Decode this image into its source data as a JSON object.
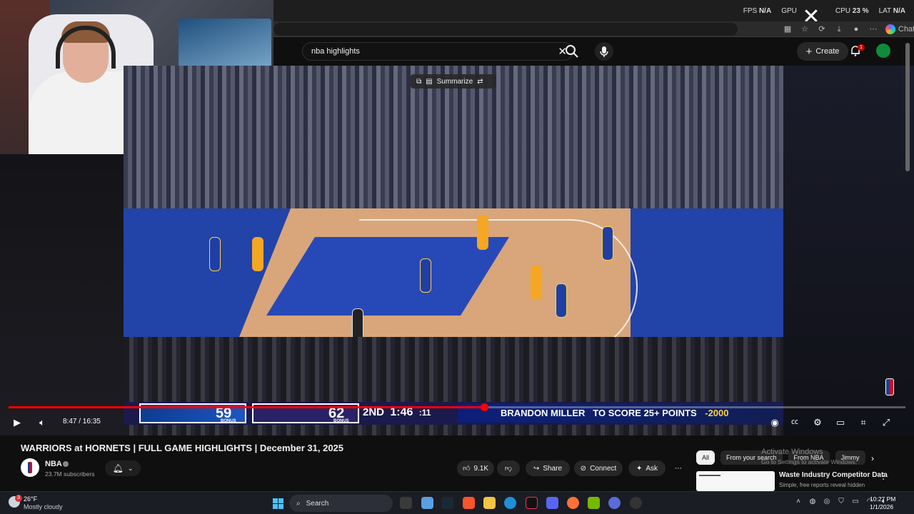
{
  "overlay": {
    "fps_label": "FPS",
    "fps_value": "N/A",
    "gpu_label": "GPU",
    "cpu_label": "CPU",
    "cpu_value": "23 %",
    "lat_label": "LAT",
    "lat_value": "N/A"
  },
  "browser": {
    "chat_label": "Chat"
  },
  "youtube": {
    "search_value": "nba highlights",
    "create_label": "Create",
    "notifications_count": "1",
    "summarize_label": "Summarize"
  },
  "scorebug": {
    "home_score": "59",
    "away_score": "62",
    "bonus_label": "BONUS",
    "period": "2ND",
    "clock": "1:46",
    "shot_clock": ":11",
    "prop_text": "BRANDON MILLER",
    "prop_line": "TO SCORE 25+ POINTS",
    "prop_odds": "-2000"
  },
  "player": {
    "current_time": "8:47",
    "duration": "16:35",
    "time_display": "8:47 / 16:35",
    "progress": 0.53
  },
  "video": {
    "title": "WARRIORS at HORNETS | FULL GAME HIGHLIGHTS | December 31, 2025",
    "channel_name": "NBA",
    "subscribers": "23.7M subscribers",
    "likes": "9.1K",
    "share_label": "Share",
    "connect_label": "Connect",
    "ask_label": "Ask"
  },
  "chips": [
    "All",
    "From your search",
    "From NBA",
    "Jimmy"
  ],
  "watermark": {
    "line1": "Activate Windows",
    "line2": "Go to Settings to activate Windows."
  },
  "ad": {
    "title": "Waste Industry Competitor Data",
    "subtitle": "Simple, free reports reveal hidden"
  },
  "taskbar": {
    "weather_temp": "26°F",
    "weather_desc": "Mostly cloudy",
    "weather_badge": "3",
    "search_label": "Search",
    "time": "10:27 PM",
    "date": "1/1/2026"
  },
  "colors": {
    "youtube_red": "#ff0000",
    "background": "#0f0f0f",
    "taskbar": "#1b1d24"
  }
}
